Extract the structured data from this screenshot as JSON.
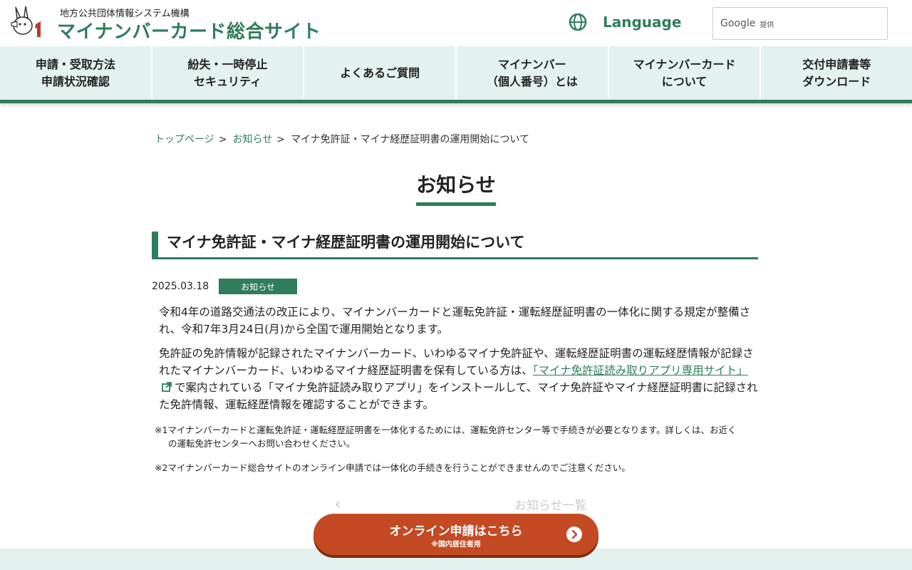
{
  "header": {
    "org_name": "地方公共団体情報システム機構",
    "site_title": "マイナンバーカード総合サイト",
    "language_label": "Language",
    "search_brand": "Google",
    "search_provided": "提供"
  },
  "nav": {
    "items": [
      {
        "label": "申請・受取方法\n申請状況確認"
      },
      {
        "label": "紛失・一時停止\nセキュリティ"
      },
      {
        "label": "よくあるご質問"
      },
      {
        "label": "マイナンバー\n（個人番号）とは"
      },
      {
        "label": "マイナンバーカード\nについて"
      },
      {
        "label": "交付申請書等\nダウンロード"
      }
    ]
  },
  "breadcrumb": {
    "home": "トップページ",
    "notices": "お知らせ",
    "current": "マイナ免許証・マイナ経歴証明書の運用開始について",
    "separator": ">"
  },
  "page_title": "お知らせ",
  "article": {
    "title": "マイナ免許証・マイナ経歴証明書の運用開始について",
    "date": "2025.03.18",
    "category": "お知らせ",
    "p1": "令和4年の道路交通法の改正により、マイナンバーカードと運転免許証・運転経歴証明書の一体化に関する規定が整備され、令和7年3月24日(月)から全国で運用開始となります。",
    "p2_before": "免許証の免許情報が記録されたマイナンバーカード、いわゆるマイナ免許証や、運転経歴証明書の運転経歴情報が記録されたマイナンバーカード、いわゆるマイナ経歴証明書を保有している方は、",
    "p2_link": "「マイナ免許証読み取りアプリ専用サイト」",
    "p2_after": "で案内されている「マイナ免許証読み取りアプリ」をインストールして、マイナ免許証やマイナ経歴証明書に記録された免許情報、運転経歴情報を確認することができます。",
    "note1_line1": "※1マイナンバーカードと運転免許証・運転経歴証明書を一体化するためには、運転免許センター等で手続きが必要となります。詳しくは、お近く",
    "note1_line2": "の運転免許センターへお問い合わせください。",
    "note2": "※2マイナンバーカード総合サイトのオンライン申請では一体化の手続きを行うことができませんのでご注意ください。"
  },
  "pager": {
    "prev": "‹",
    "list": "お知らせ一覧"
  },
  "cta": {
    "label": "オンライン申請はこちら",
    "sub": "※国内居住者用"
  },
  "colors": {
    "brand_green": "#2e7d5b",
    "nav_bg": "#e3f2ee",
    "cta_orange": "#c44a23"
  }
}
